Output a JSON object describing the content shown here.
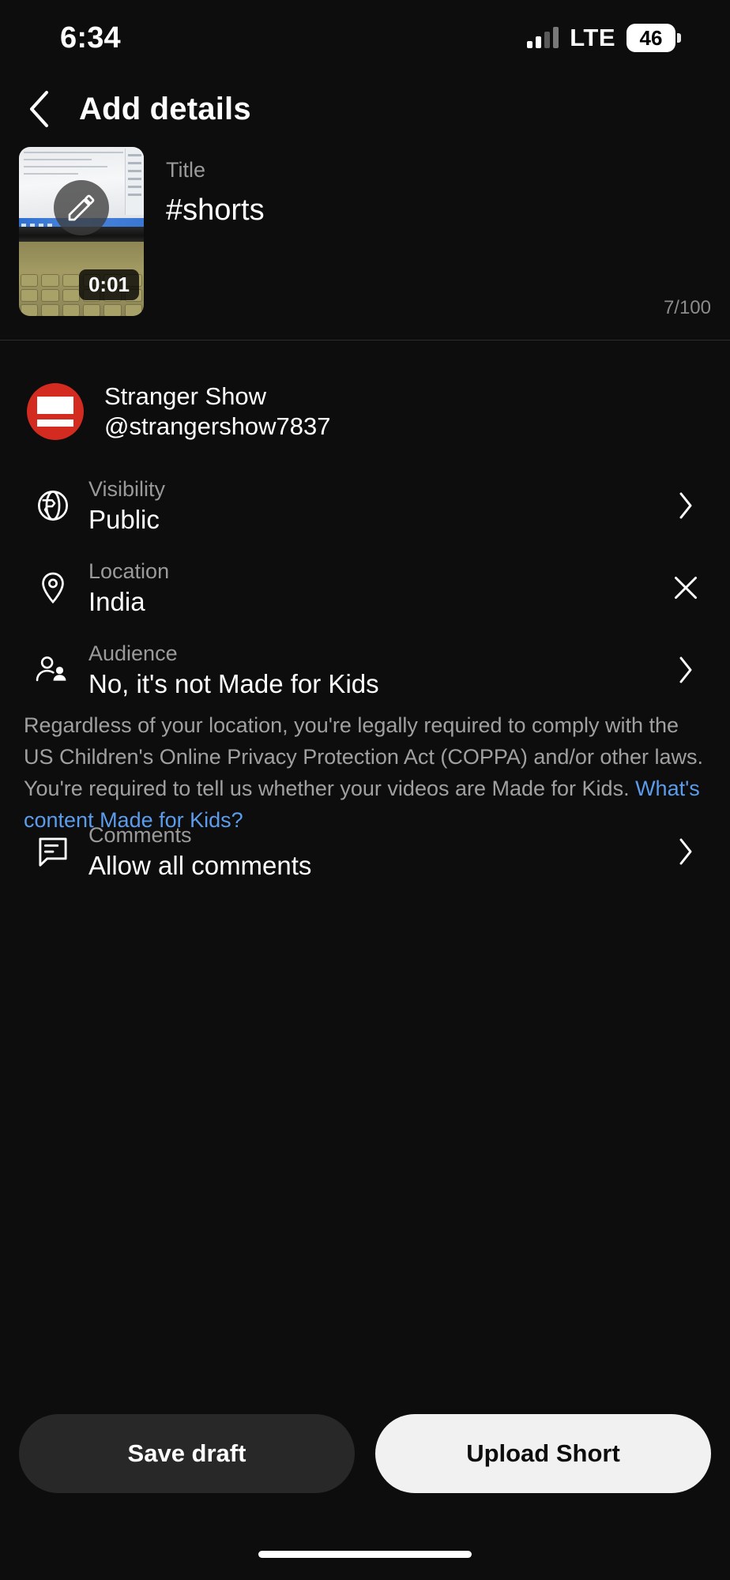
{
  "status_bar": {
    "time": "6:34",
    "network": "LTE",
    "battery_level": "46",
    "signal_icon": "signal-bars-icon",
    "battery_icon": "battery-icon"
  },
  "header": {
    "title": "Add details",
    "back_icon": "back-chevron-icon"
  },
  "video": {
    "duration": "0:01",
    "edit_icon": "pencil-edit-icon",
    "thumbnail_alt": "laptop-screen-keyboard-thumbnail"
  },
  "title_field": {
    "label": "Title",
    "value": "#shorts",
    "char_counter": "7/100"
  },
  "channel": {
    "name": "Stranger Show",
    "handle": "@strangershow7837",
    "avatar_icon": "channel-avatar"
  },
  "settings": [
    {
      "label": "Visibility",
      "value": "Public",
      "icon": "globe-icon",
      "action_icon": "chevron-right-icon"
    },
    {
      "label": "Location",
      "value": "India",
      "icon": "location-pin-icon",
      "action_icon": "close-x-icon"
    },
    {
      "label": "Audience",
      "value": "No, it's not Made for Kids",
      "icon": "audience-people-icon",
      "action_icon": "chevron-right-icon"
    },
    {
      "label": "Comments",
      "value": "Allow all comments",
      "icon": "comment-bubble-icon",
      "action_icon": "chevron-right-icon"
    }
  ],
  "coppa_notice": {
    "text": "Regardless of your location, you're legally required to comply with the US Children's Online Privacy Protection Act (COPPA) and/or other laws. You're required to tell us whether your videos are Made for Kids. ",
    "link_text": "What's content Made for Kids?"
  },
  "actions": {
    "save_draft": "Save draft",
    "upload": "Upload Short"
  },
  "colors": {
    "background": "#0d0d0d",
    "accent_red": "#d32b20",
    "link_blue": "#5c9ced",
    "primary_button": "#f1f1f1",
    "secondary_button": "#282828"
  }
}
